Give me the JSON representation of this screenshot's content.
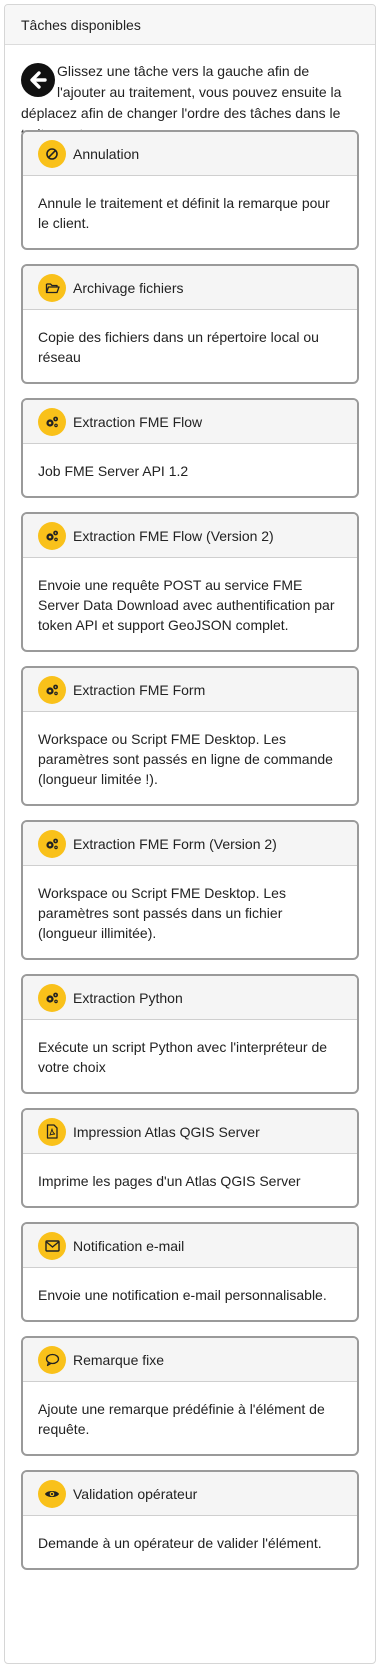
{
  "panel": {
    "title": "Tâches disponibles",
    "instructions": "Glissez une tâche vers la gauche afin de l'ajouter au traitement, vous pouvez ensuite la déplacez afin de changer l'ordre des tâches dans le traitement."
  },
  "colors": {
    "icon_bg": "#f9c11a",
    "card_border": "#9a9a9a",
    "header_bg": "#f5f5f5"
  },
  "tasks": [
    {
      "title": "Annulation",
      "icon": "ban-icon",
      "description": "Annule le traitement et définit la remarque pour le client."
    },
    {
      "title": "Archivage fichiers",
      "icon": "folder-open-icon",
      "description": "Copie des fichiers dans un répertoire local ou réseau"
    },
    {
      "title": "Extraction FME Flow",
      "icon": "gears-icon",
      "description": "Job FME Server API 1.2"
    },
    {
      "title": "Extraction FME Flow (Version 2)",
      "icon": "gears-icon",
      "description": "Envoie une requête POST au service FME Server Data Download avec authentification par token API et support GeoJSON complet."
    },
    {
      "title": "Extraction FME Form",
      "icon": "gears-icon",
      "description": "Workspace ou Script FME Desktop. Les paramètres sont passés en ligne de commande (longueur limitée !)."
    },
    {
      "title": "Extraction FME Form (Version 2)",
      "icon": "gears-icon",
      "description": "Workspace ou Script FME Desktop. Les paramètres sont passés dans un fichier (longueur illimitée)."
    },
    {
      "title": "Extraction Python",
      "icon": "gears-icon",
      "description": "Exécute un script Python avec l'interpréteur de votre choix"
    },
    {
      "title": "Impression Atlas QGIS Server",
      "icon": "pdf-file-icon",
      "description": "Imprime les pages d'un Atlas QGIS Server"
    },
    {
      "title": "Notification e-mail",
      "icon": "envelope-icon",
      "description": "Envoie une notification e-mail personnalisable."
    },
    {
      "title": "Remarque fixe",
      "icon": "comment-icon",
      "description": "Ajoute une remarque prédéfinie à l'élément de requête."
    },
    {
      "title": "Validation opérateur",
      "icon": "eye-icon",
      "description": "Demande à un opérateur de valider l'élément."
    }
  ]
}
